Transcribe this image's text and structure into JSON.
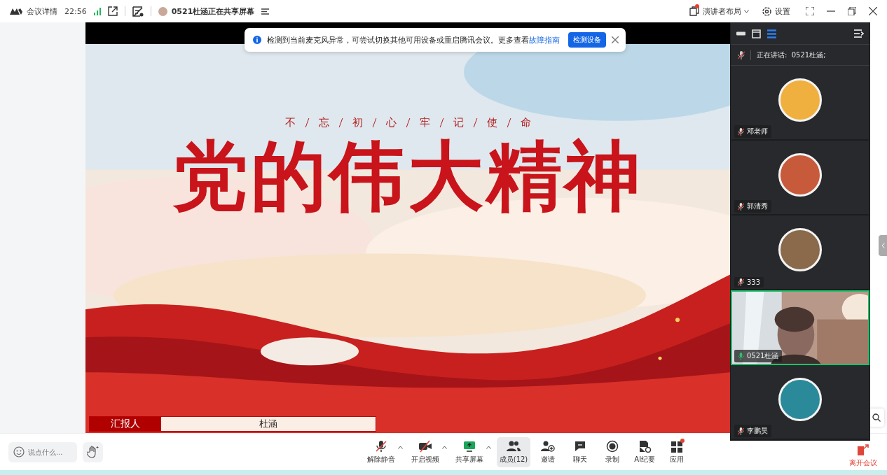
{
  "title_bar": {
    "title": "会议详情",
    "time": "22:56",
    "sharing_status": "0521杜涵正在共享屏幕",
    "layout_button": {
      "label": "演讲者布局",
      "badge": true
    },
    "settings_button": {
      "label": "设置"
    }
  },
  "notice": {
    "text": "检测到当前麦克风异常，可尝试切换其他可用设备或重启腾讯会议。更多查看",
    "link": "故障指南",
    "button": "检测设备"
  },
  "slide": {
    "tagline": [
      "不",
      "忘",
      "初",
      "心",
      "牢",
      "记",
      "使",
      "命"
    ],
    "title": "党的伟大精神",
    "presenter_label": "汇报人",
    "presenter_name": "杜涵"
  },
  "panel": {
    "views": [
      {
        "kind": "strip",
        "selected": false
      },
      {
        "kind": "window",
        "selected": false
      },
      {
        "kind": "list",
        "selected": true
      }
    ],
    "speaking": "正在讲话:  0521杜涵;",
    "participants": [
      {
        "name": "邓老师",
        "muted": true,
        "selected": false,
        "kind": "avatar",
        "color": "#f0b040"
      },
      {
        "name": "郭清秀",
        "muted": true,
        "selected": false,
        "kind": "avatar",
        "color": "#c85a3c"
      },
      {
        "name": "333",
        "muted": true,
        "selected": false,
        "kind": "avatar",
        "color": "#8a6a4a"
      },
      {
        "name": "0521杜涵",
        "muted": false,
        "selected": true,
        "kind": "video"
      },
      {
        "name": "李鹏昊",
        "muted": true,
        "selected": false,
        "kind": "avatar",
        "color": "#2a8a9a"
      }
    ]
  },
  "chat_input": {
    "placeholder": "说点什么..."
  },
  "toolbar": [
    {
      "kind": "mic",
      "label": "解除静音",
      "menu": true,
      "selected": false,
      "badge": false
    },
    {
      "kind": "video",
      "label": "开启视频",
      "menu": true,
      "selected": false,
      "badge": false
    },
    {
      "kind": "share",
      "label": "共享屏幕",
      "menu": true,
      "selected": false,
      "badge": false
    },
    {
      "kind": "members",
      "label": "成员(12)",
      "menu": false,
      "selected": true,
      "badge": false
    },
    {
      "kind": "invite",
      "label": "邀请",
      "menu": false,
      "selected": false,
      "badge": false
    },
    {
      "kind": "chat",
      "label": "聊天",
      "menu": false,
      "selected": false,
      "badge": false
    },
    {
      "kind": "record",
      "label": "录制",
      "menu": false,
      "selected": false,
      "badge": false
    },
    {
      "kind": "notes",
      "label": "AI纪要",
      "menu": false,
      "selected": false,
      "badge": false
    },
    {
      "kind": "apps",
      "label": "应用",
      "menu": false,
      "selected": false,
      "badge": true
    }
  ],
  "leave_button": "离开会议"
}
